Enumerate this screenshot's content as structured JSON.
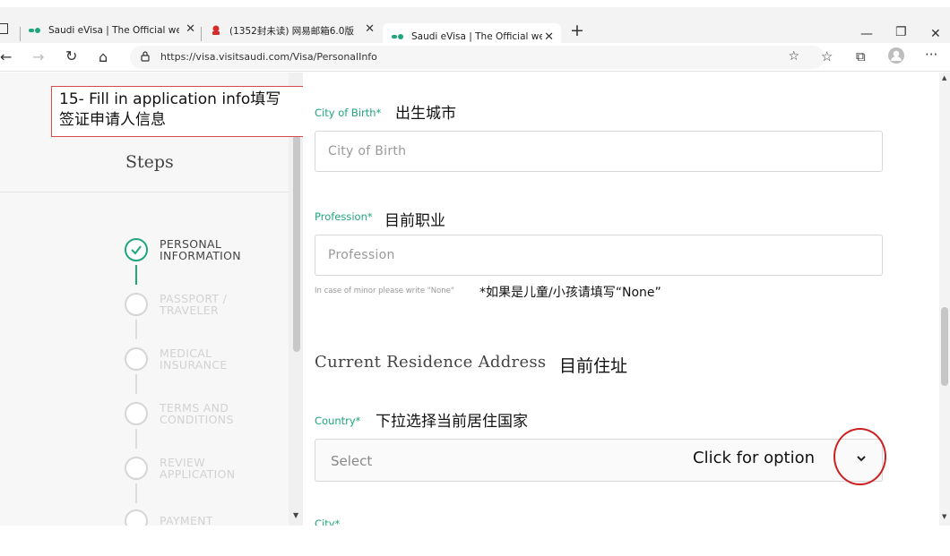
{
  "browser": {
    "tabs": [
      {
        "title": "Saudi eVisa | The Official website",
        "active": false
      },
      {
        "title": "(1352封未读) 网易邮箱6.0版",
        "active": false
      },
      {
        "title": "Saudi eVisa | The Official website",
        "active": true
      }
    ],
    "new_tab": "+",
    "url": "https://visa.visitsaudi.com/Visa/PersonalInfo"
  },
  "annotation": {
    "text": "15- Fill in application info填写签证申请人信息"
  },
  "steps": {
    "title": "Steps",
    "items": [
      {
        "label": "PERSONAL\nINFORMATION",
        "done": true
      },
      {
        "label": "PASSPORT /\nTRAVELER",
        "done": false
      },
      {
        "label": "MEDICAL\nINSURANCE",
        "done": false
      },
      {
        "label": "TERMS AND\nCONDITIONS",
        "done": false
      },
      {
        "label": "REVIEW\nAPPLICATION",
        "done": false
      },
      {
        "label": "PAYMENT",
        "done": false
      }
    ]
  },
  "form": {
    "city_of_birth": {
      "label": "City of Birth*",
      "note": "出生城市",
      "placeholder": "City of Birth"
    },
    "profession": {
      "label": "Profession*",
      "note": "目前职业",
      "placeholder": "Profession",
      "hint": "In case of minor please write \"None\"",
      "hint_note": "*如果是儿童/小孩请填写“None”"
    },
    "residence_section": {
      "title": "Current Residence Address",
      "note": "目前住址"
    },
    "country": {
      "label": "Country*",
      "note": "下拉选择当前居住国家",
      "placeholder": "Select",
      "click_note": "Click for option"
    },
    "city": {
      "label": "City*"
    }
  },
  "colors": {
    "accent_green": "#20a57e",
    "annotation_red": "#cc2020"
  }
}
